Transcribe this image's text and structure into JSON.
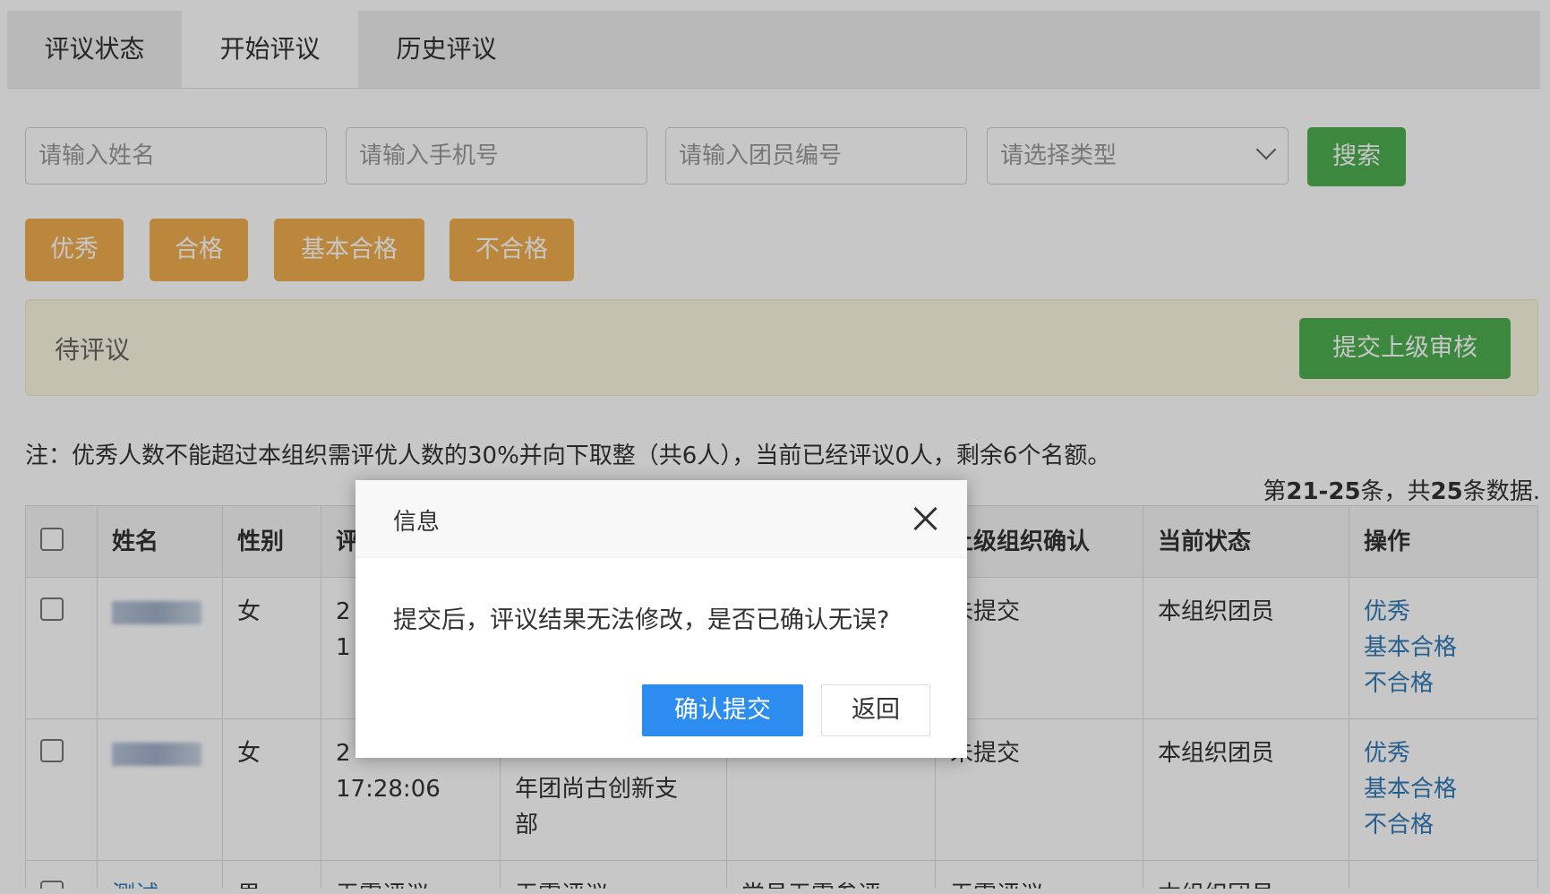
{
  "tabs": [
    "评议状态",
    "开始评议",
    "历史评议"
  ],
  "search": {
    "name_placeholder": "请输入姓名",
    "phone_placeholder": "请输入手机号",
    "member_id_placeholder": "请输入团员编号",
    "type_placeholder": "请选择类型",
    "search_label": "搜索"
  },
  "ratings": [
    "优秀",
    "合格",
    "基本合格",
    "不合格"
  ],
  "pending": {
    "label": "待评议",
    "submit_label": "提交上级审核"
  },
  "note": "注：优秀人数不能超过本组织需评优人数的30%并向下取整（共6人），当前已经评议0人，剩余6个名额。",
  "pagination": {
    "prefix": "第",
    "range": "21-25",
    "middle": "条，共",
    "total": "25",
    "suffix": "条数据."
  },
  "table": {
    "headers": [
      "姓名",
      "性别",
      "评",
      "上级组织确认",
      "当前状态",
      "操作"
    ],
    "rows": [
      {
        "gender": "女",
        "date_line1": "2",
        "date_line2": "1",
        "org": "",
        "confirm": "未提交",
        "status": "本组织团员",
        "actions": [
          "优秀",
          "基本合格",
          "不合格"
        ]
      },
      {
        "gender": "女",
        "date_line1": "2",
        "date_line2": "17:28:06",
        "org_line1": "年团尚古创新支",
        "org_line2": "部",
        "confirm": "未提交",
        "status": "本组织团员",
        "actions": [
          "优秀",
          "基本合格",
          "不合格"
        ]
      }
    ],
    "partial_row": {
      "name": "测试",
      "gender": "男",
      "c3": "无需评议",
      "c4": "无需评议",
      "c5": "党员无需参评",
      "c6": "无需评议",
      "c7": "本组织团员"
    }
  },
  "dialog": {
    "title": "信息",
    "message": "提交后，评议结果无法修改，是否已确认无误?",
    "confirm_label": "确认提交",
    "back_label": "返回"
  }
}
